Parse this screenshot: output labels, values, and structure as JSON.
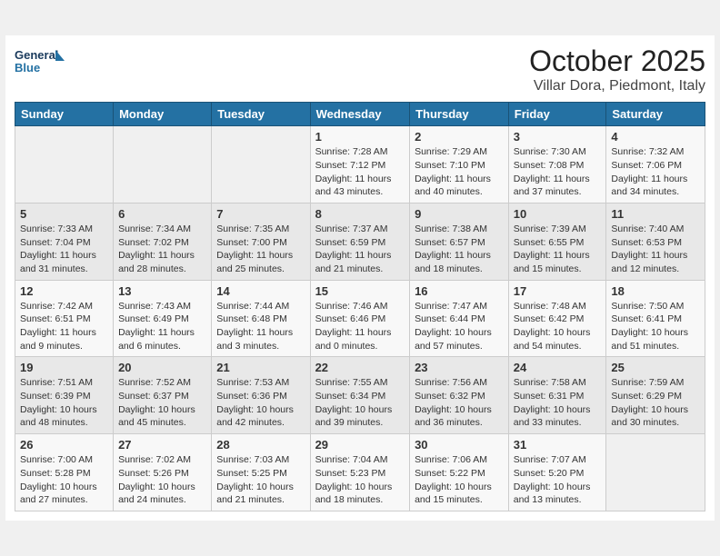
{
  "header": {
    "logo_text_general": "General",
    "logo_text_blue": "Blue",
    "month": "October 2025",
    "location": "Villar Dora, Piedmont, Italy"
  },
  "days_of_week": [
    "Sunday",
    "Monday",
    "Tuesday",
    "Wednesday",
    "Thursday",
    "Friday",
    "Saturday"
  ],
  "weeks": [
    [
      {
        "day": "",
        "info": ""
      },
      {
        "day": "",
        "info": ""
      },
      {
        "day": "",
        "info": ""
      },
      {
        "day": "1",
        "info": "Sunrise: 7:28 AM\nSunset: 7:12 PM\nDaylight: 11 hours and 43 minutes."
      },
      {
        "day": "2",
        "info": "Sunrise: 7:29 AM\nSunset: 7:10 PM\nDaylight: 11 hours and 40 minutes."
      },
      {
        "day": "3",
        "info": "Sunrise: 7:30 AM\nSunset: 7:08 PM\nDaylight: 11 hours and 37 minutes."
      },
      {
        "day": "4",
        "info": "Sunrise: 7:32 AM\nSunset: 7:06 PM\nDaylight: 11 hours and 34 minutes."
      }
    ],
    [
      {
        "day": "5",
        "info": "Sunrise: 7:33 AM\nSunset: 7:04 PM\nDaylight: 11 hours and 31 minutes."
      },
      {
        "day": "6",
        "info": "Sunrise: 7:34 AM\nSunset: 7:02 PM\nDaylight: 11 hours and 28 minutes."
      },
      {
        "day": "7",
        "info": "Sunrise: 7:35 AM\nSunset: 7:00 PM\nDaylight: 11 hours and 25 minutes."
      },
      {
        "day": "8",
        "info": "Sunrise: 7:37 AM\nSunset: 6:59 PM\nDaylight: 11 hours and 21 minutes."
      },
      {
        "day": "9",
        "info": "Sunrise: 7:38 AM\nSunset: 6:57 PM\nDaylight: 11 hours and 18 minutes."
      },
      {
        "day": "10",
        "info": "Sunrise: 7:39 AM\nSunset: 6:55 PM\nDaylight: 11 hours and 15 minutes."
      },
      {
        "day": "11",
        "info": "Sunrise: 7:40 AM\nSunset: 6:53 PM\nDaylight: 11 hours and 12 minutes."
      }
    ],
    [
      {
        "day": "12",
        "info": "Sunrise: 7:42 AM\nSunset: 6:51 PM\nDaylight: 11 hours and 9 minutes."
      },
      {
        "day": "13",
        "info": "Sunrise: 7:43 AM\nSunset: 6:49 PM\nDaylight: 11 hours and 6 minutes."
      },
      {
        "day": "14",
        "info": "Sunrise: 7:44 AM\nSunset: 6:48 PM\nDaylight: 11 hours and 3 minutes."
      },
      {
        "day": "15",
        "info": "Sunrise: 7:46 AM\nSunset: 6:46 PM\nDaylight: 11 hours and 0 minutes."
      },
      {
        "day": "16",
        "info": "Sunrise: 7:47 AM\nSunset: 6:44 PM\nDaylight: 10 hours and 57 minutes."
      },
      {
        "day": "17",
        "info": "Sunrise: 7:48 AM\nSunset: 6:42 PM\nDaylight: 10 hours and 54 minutes."
      },
      {
        "day": "18",
        "info": "Sunrise: 7:50 AM\nSunset: 6:41 PM\nDaylight: 10 hours and 51 minutes."
      }
    ],
    [
      {
        "day": "19",
        "info": "Sunrise: 7:51 AM\nSunset: 6:39 PM\nDaylight: 10 hours and 48 minutes."
      },
      {
        "day": "20",
        "info": "Sunrise: 7:52 AM\nSunset: 6:37 PM\nDaylight: 10 hours and 45 minutes."
      },
      {
        "day": "21",
        "info": "Sunrise: 7:53 AM\nSunset: 6:36 PM\nDaylight: 10 hours and 42 minutes."
      },
      {
        "day": "22",
        "info": "Sunrise: 7:55 AM\nSunset: 6:34 PM\nDaylight: 10 hours and 39 minutes."
      },
      {
        "day": "23",
        "info": "Sunrise: 7:56 AM\nSunset: 6:32 PM\nDaylight: 10 hours and 36 minutes."
      },
      {
        "day": "24",
        "info": "Sunrise: 7:58 AM\nSunset: 6:31 PM\nDaylight: 10 hours and 33 minutes."
      },
      {
        "day": "25",
        "info": "Sunrise: 7:59 AM\nSunset: 6:29 PM\nDaylight: 10 hours and 30 minutes."
      }
    ],
    [
      {
        "day": "26",
        "info": "Sunrise: 7:00 AM\nSunset: 5:28 PM\nDaylight: 10 hours and 27 minutes."
      },
      {
        "day": "27",
        "info": "Sunrise: 7:02 AM\nSunset: 5:26 PM\nDaylight: 10 hours and 24 minutes."
      },
      {
        "day": "28",
        "info": "Sunrise: 7:03 AM\nSunset: 5:25 PM\nDaylight: 10 hours and 21 minutes."
      },
      {
        "day": "29",
        "info": "Sunrise: 7:04 AM\nSunset: 5:23 PM\nDaylight: 10 hours and 18 minutes."
      },
      {
        "day": "30",
        "info": "Sunrise: 7:06 AM\nSunset: 5:22 PM\nDaylight: 10 hours and 15 minutes."
      },
      {
        "day": "31",
        "info": "Sunrise: 7:07 AM\nSunset: 5:20 PM\nDaylight: 10 hours and 13 minutes."
      },
      {
        "day": "",
        "info": ""
      }
    ]
  ]
}
